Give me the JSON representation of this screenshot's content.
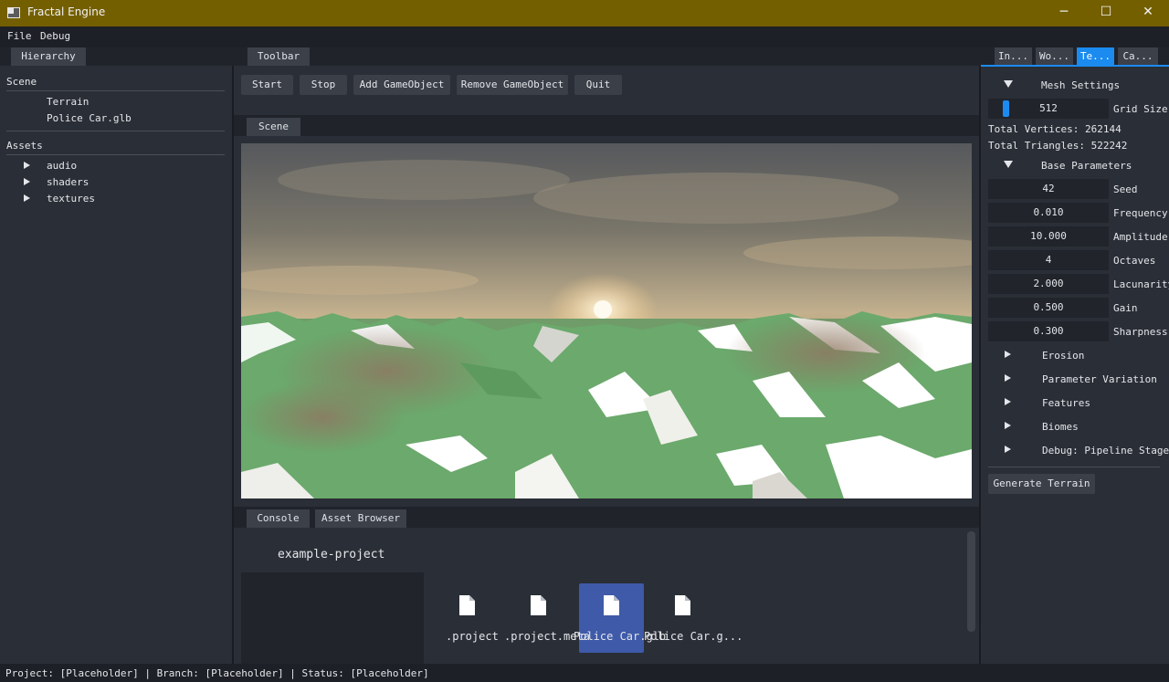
{
  "window": {
    "title": "Fractal Engine",
    "minimize_glyph": "─",
    "maximize_glyph": "☐",
    "close_glyph": "✕"
  },
  "menubar": {
    "items": [
      "File",
      "Debug"
    ]
  },
  "hierarchy": {
    "tab": "Hierarchy",
    "scene_header": "Scene",
    "scene_items": [
      "Terrain",
      "Police Car.glb"
    ],
    "assets_header": "Assets",
    "asset_folders": [
      "audio",
      "shaders",
      "textures"
    ]
  },
  "toolbar": {
    "tab": "Toolbar",
    "buttons": [
      "Start",
      "Stop",
      "Add GameObject",
      "Remove GameObject",
      "Quit"
    ]
  },
  "scene": {
    "tab": "Scene"
  },
  "bottom": {
    "tabs": [
      "Console",
      "Asset Browser"
    ],
    "project_name": "example-project",
    "files": [
      ".project",
      ".project.meta",
      "Police Car.glb",
      "Police Car.g..."
    ],
    "selected_file_index": 2
  },
  "right_tabs": [
    "In...",
    "Wo...",
    "Te...",
    "Ca..."
  ],
  "right_active_tab_index": 2,
  "terrain": {
    "mesh_settings": "Mesh Settings",
    "grid_size_value": "512",
    "grid_size_label": "Grid Size",
    "total_vertices": "Total Vertices: 262144",
    "total_triangles": "Total Triangles: 522242",
    "base_parameters": "Base Parameters",
    "params": [
      {
        "value": "42",
        "label": "Seed"
      },
      {
        "value": "0.010",
        "label": "Frequency"
      },
      {
        "value": "10.000",
        "label": "Amplitude"
      },
      {
        "value": "4",
        "label": "Octaves"
      },
      {
        "value": "2.000",
        "label": "Lacunarity"
      },
      {
        "value": "0.500",
        "label": "Gain"
      },
      {
        "value": "0.300",
        "label": "Sharpness"
      }
    ],
    "collapsed_sections": [
      "Erosion",
      "Parameter Variation",
      "Features",
      "Biomes",
      "Debug: Pipeline Stages"
    ],
    "generate_button": "Generate Terrain"
  },
  "statusbar": {
    "text": "Project: [Placeholder] | Branch: [Placeholder] | Status: [Placeholder]"
  },
  "colors": {
    "titlebar": "#745f00",
    "accent": "#1b8bf0",
    "panel": "#2a2e36",
    "selection": "#3e5aa8"
  }
}
